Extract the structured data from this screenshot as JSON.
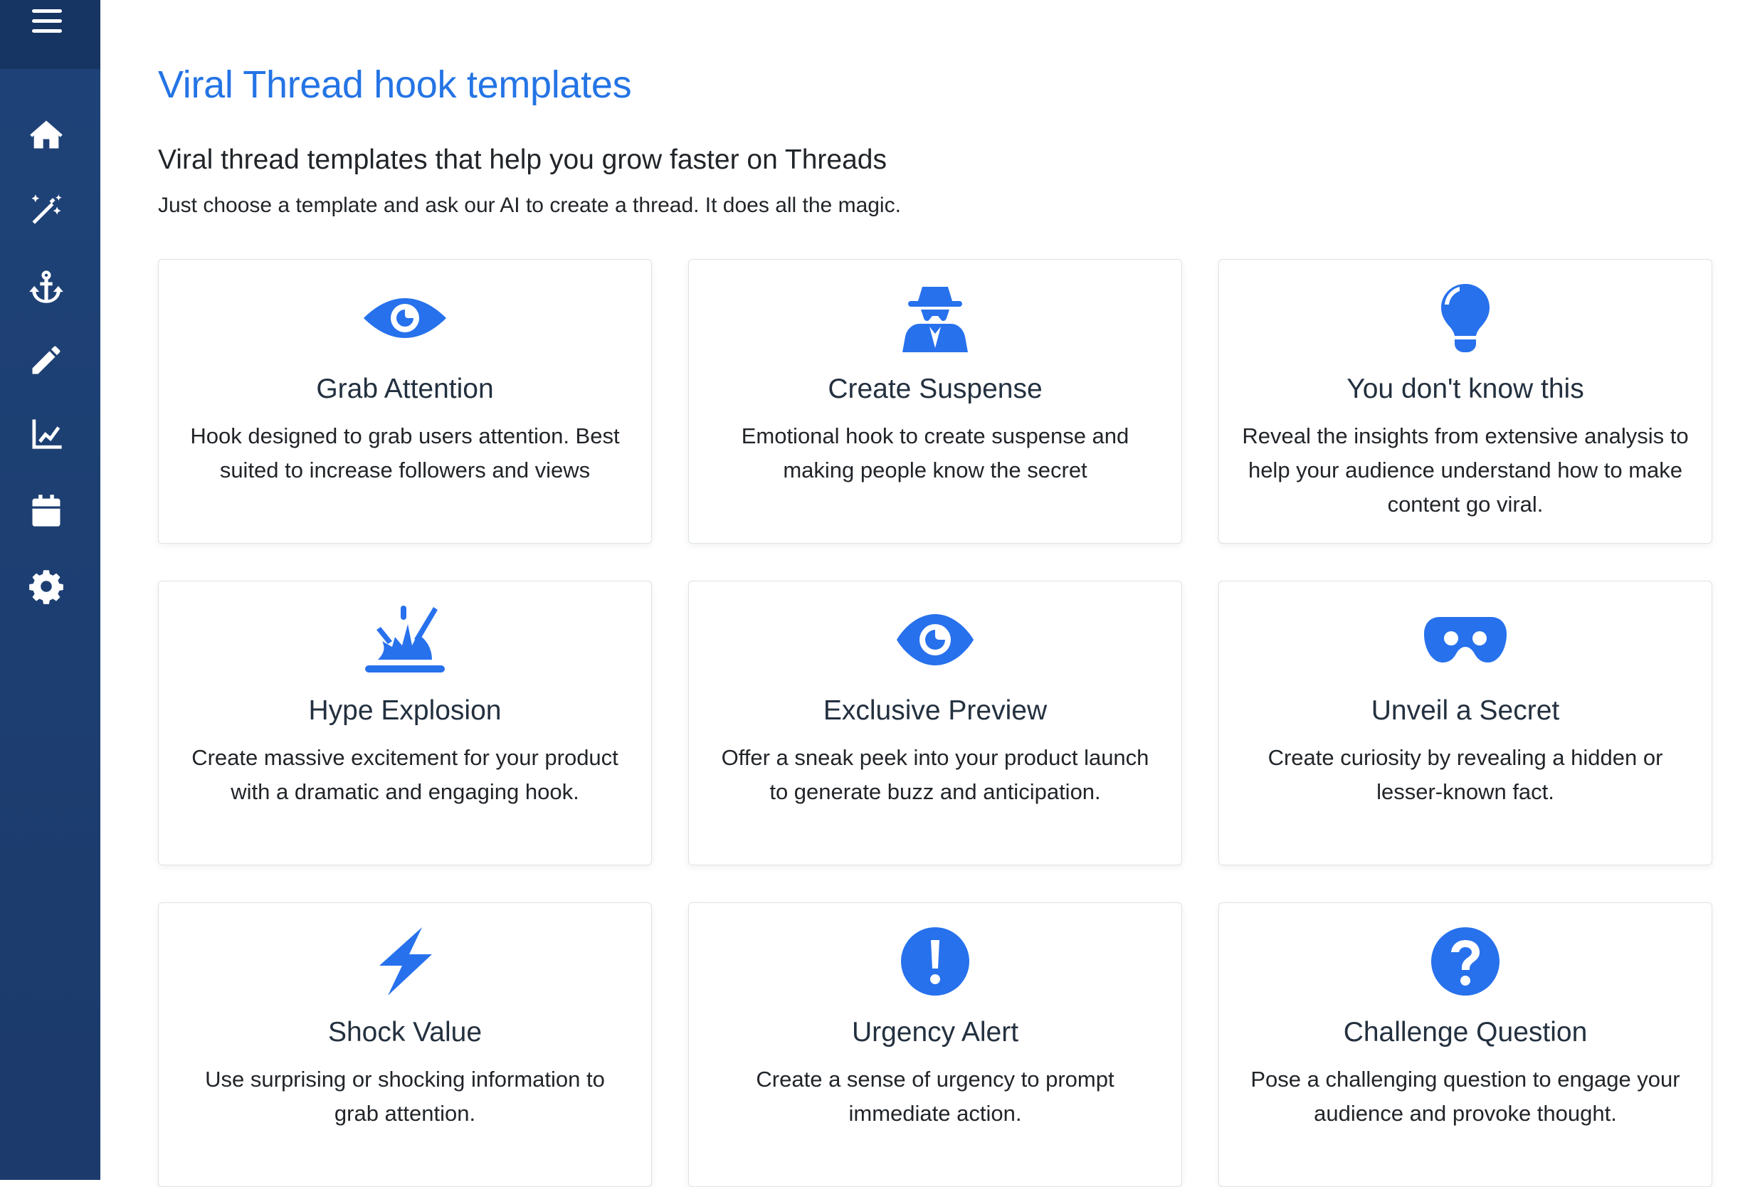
{
  "sidebar": {
    "items": [
      {
        "icon": "home-icon"
      },
      {
        "icon": "magic-wand-icon"
      },
      {
        "icon": "anchor-icon"
      },
      {
        "icon": "pencil-icon"
      },
      {
        "icon": "chart-line-icon"
      },
      {
        "icon": "calendar-icon"
      },
      {
        "icon": "gear-icon"
      }
    ]
  },
  "header": {
    "title": "Viral Thread hook templates",
    "subtitle": "Viral thread templates that help you grow faster on Threads",
    "description": "Just choose a template and ask our AI to create a thread. It does all the magic."
  },
  "accent_color": "#2771ed",
  "title_color": "#2474e5",
  "templates": [
    {
      "icon": "eye-icon",
      "title": "Grab Attention",
      "description": "Hook designed to grab users attention. Best suited to increase followers and views"
    },
    {
      "icon": "spy-icon",
      "title": "Create Suspense",
      "description": "Emotional hook to create suspense and making people know the secret"
    },
    {
      "icon": "lightbulb-icon",
      "title": "You don't know this",
      "description": "Reveal the insights from extensive analysis to help your audience understand how to make content go viral."
    },
    {
      "icon": "explosion-icon",
      "title": "Hype Explosion",
      "description": "Create massive excitement for your product with a dramatic and engaging hook."
    },
    {
      "icon": "eye-icon",
      "title": "Exclusive Preview",
      "description": "Offer a sneak peek into your product launch to generate buzz and anticipation."
    },
    {
      "icon": "mask-icon",
      "title": "Unveil a Secret",
      "description": "Create curiosity by revealing a hidden or lesser-known fact."
    },
    {
      "icon": "bolt-icon",
      "title": "Shock Value",
      "description": "Use surprising or shocking information to grab attention."
    },
    {
      "icon": "exclamation-circle-icon",
      "title": "Urgency Alert",
      "description": "Create a sense of urgency to prompt immediate action."
    },
    {
      "icon": "question-circle-icon",
      "title": "Challenge Question",
      "description": "Pose a challenging question to engage your audience and provoke thought."
    }
  ]
}
